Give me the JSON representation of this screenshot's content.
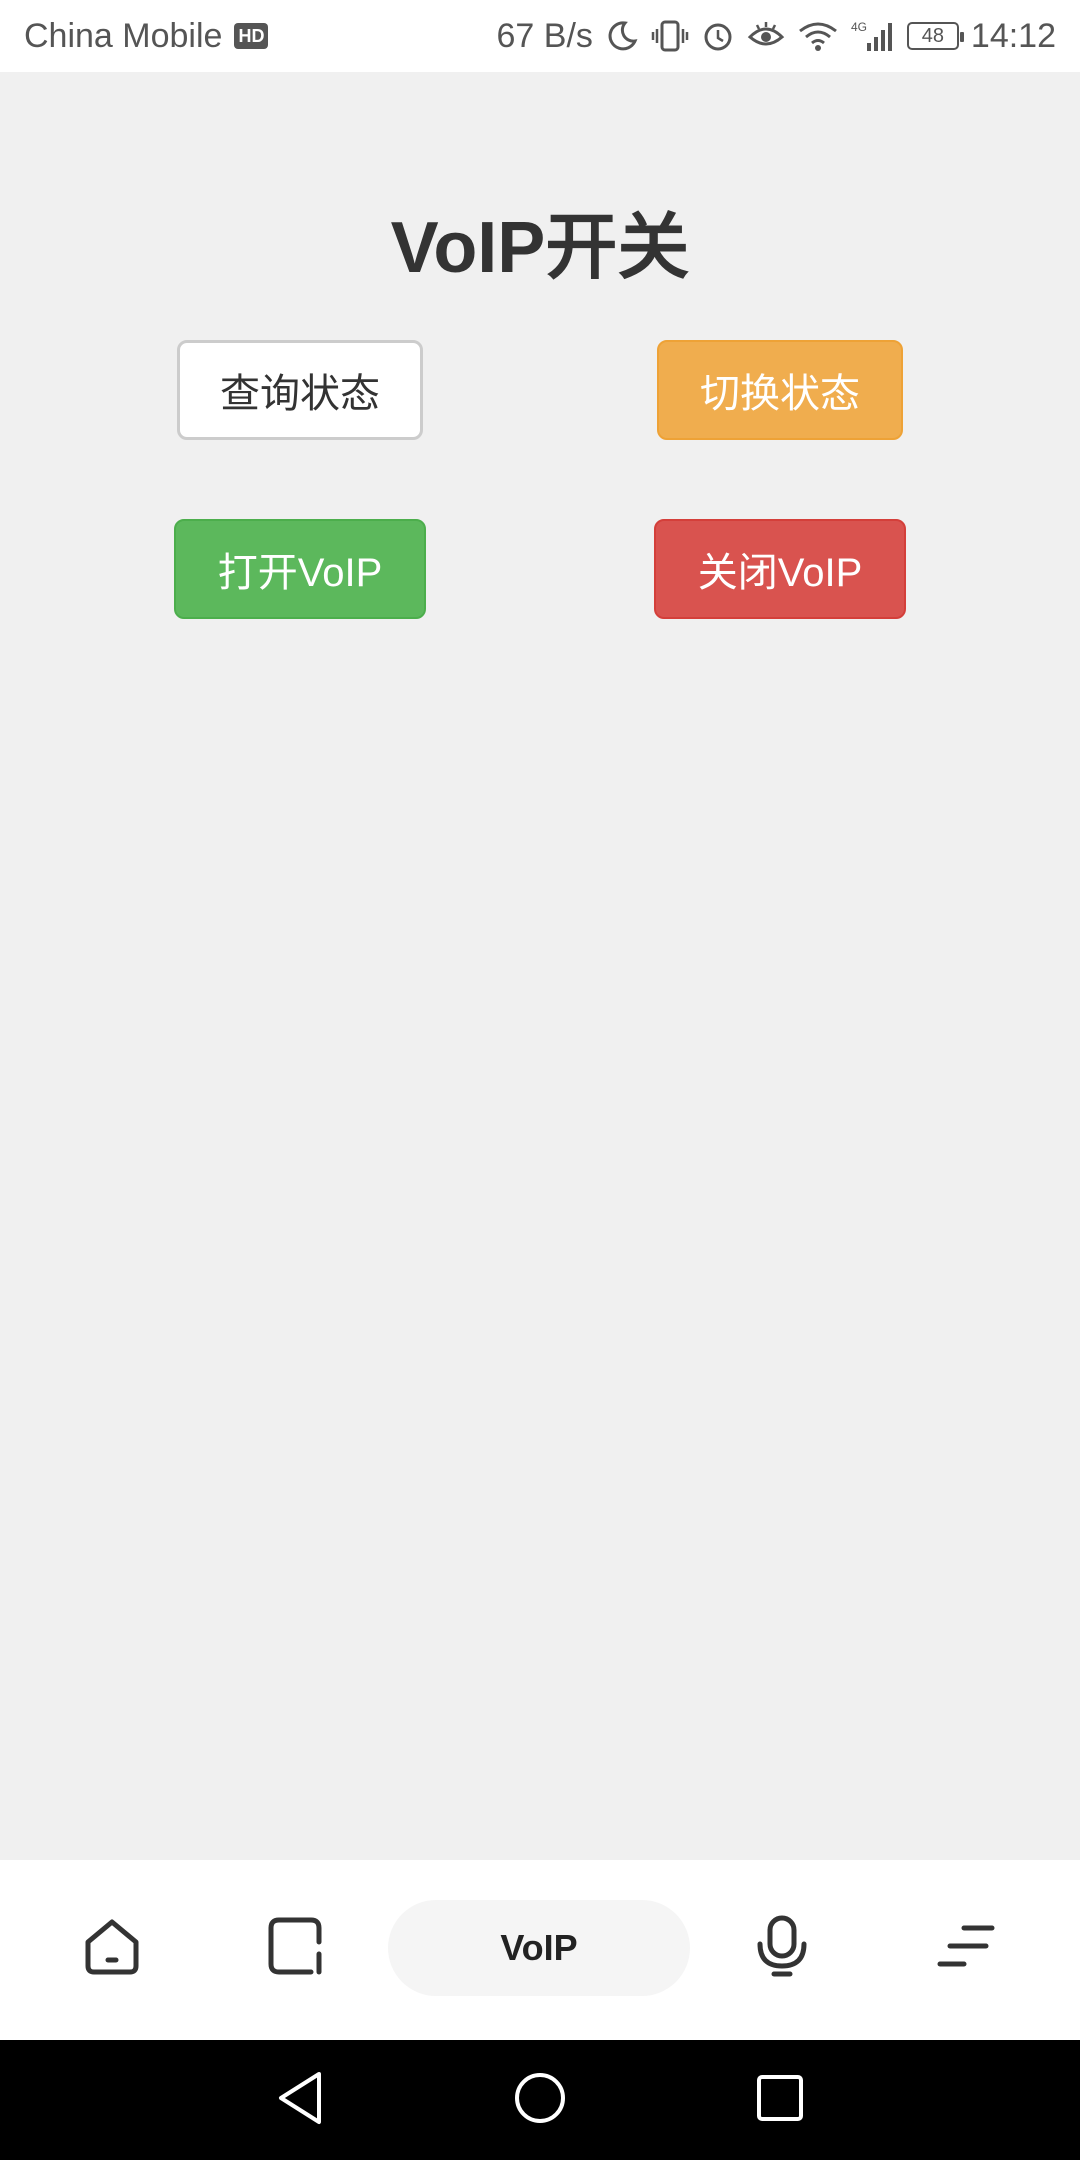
{
  "status_bar": {
    "carrier": "China Mobile",
    "hd_badge": "HD",
    "net_speed": "67 B/s",
    "network_type": "4G",
    "battery": "48",
    "time": "14:12",
    "icons": [
      "moon-icon",
      "vibrate-icon",
      "alarm-icon",
      "eye-icon",
      "wifi-icon",
      "signal-icon",
      "battery-icon"
    ]
  },
  "main": {
    "title": "VoIP开关",
    "buttons": {
      "query": "查询状态",
      "toggle": "切换状态",
      "open": "打开VoIP",
      "close": "关闭VoIP"
    }
  },
  "tab_bar": {
    "active_label": "VoIP",
    "icons": [
      "home-icon",
      "square-icon",
      "mic-icon",
      "menu-icon"
    ]
  },
  "nav_bar": {
    "icons": [
      "back-icon",
      "home-circle-icon",
      "recent-apps-icon"
    ]
  },
  "colors": {
    "toggle": "#f0ad4e",
    "open": "#5cb85c",
    "close": "#d9534f",
    "background": "#f0f0f0"
  }
}
